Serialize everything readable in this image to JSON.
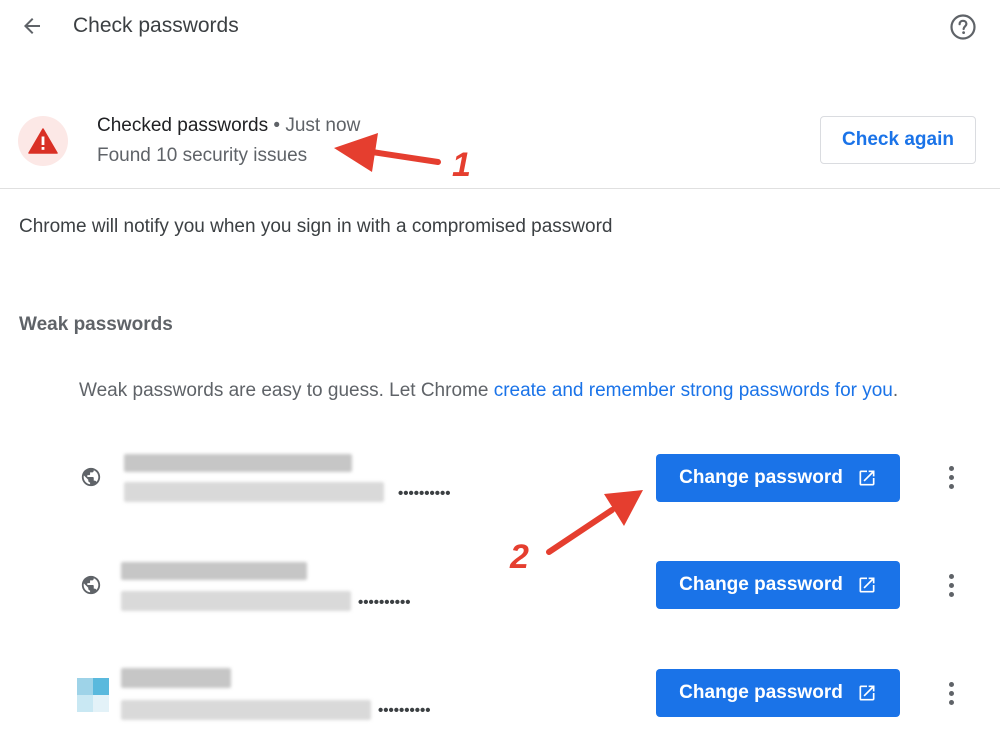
{
  "header": {
    "title": "Check passwords",
    "back_icon": "arrow-back-icon",
    "help_icon": "help-circle-icon"
  },
  "status": {
    "title": "Checked passwords",
    "separator": "•",
    "time": "Just now",
    "issues": "Found 10 security issues",
    "check_again_label": "Check again",
    "icon": "warning-triangle-icon"
  },
  "notify_text": "Chrome will notify you when you sign in with a compromised password",
  "weak": {
    "heading": "Weak passwords",
    "desc_prefix": "Weak passwords are easy to guess. Let Chrome ",
    "desc_link": "create and remember strong passwords for you",
    "desc_suffix": "."
  },
  "rows": [
    {
      "masked_password": "••••••••••",
      "button_label": "Change password",
      "site_icon": "globe-icon"
    },
    {
      "masked_password": "••••••••••",
      "button_label": "Change password",
      "site_icon": "globe-icon"
    },
    {
      "masked_password": "••••••••••",
      "button_label": "Change password",
      "site_icon": "site-favicon-icon"
    }
  ],
  "annotations": {
    "one": "1",
    "two": "2"
  },
  "colors": {
    "accent": "#1a73e8",
    "warning": "#d93025",
    "annotation": "#e53e2f"
  }
}
